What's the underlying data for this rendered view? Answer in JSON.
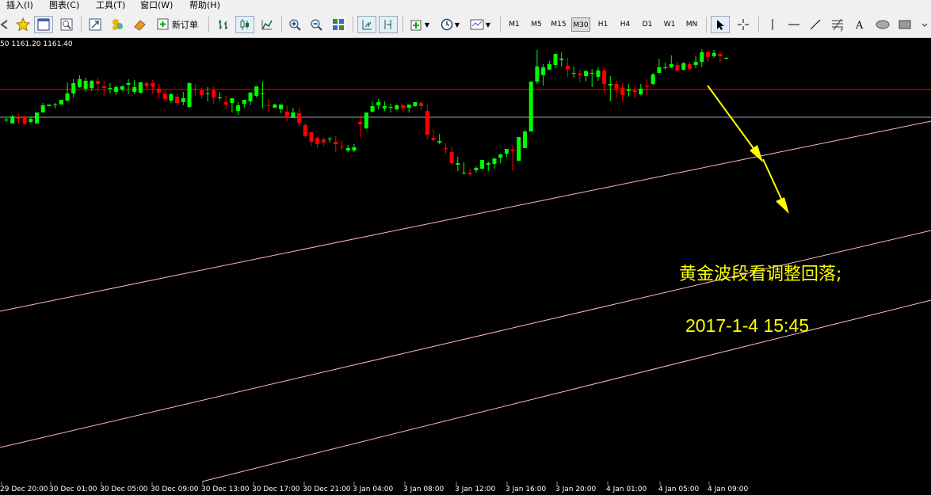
{
  "menu": [
    "插入(I)",
    "图表(C)",
    "工具(T)",
    "窗口(W)",
    "帮助(H)"
  ],
  "toolbar": {
    "new_order_label": "新订单",
    "timeframes": [
      "M1",
      "M5",
      "M15",
      "M30",
      "H1",
      "H4",
      "D1",
      "W1",
      "MN"
    ],
    "selected_timeframe": "M30"
  },
  "chart": {
    "price_info": "50 1161.20 1161.40",
    "annotation_title": "黄金波段看调整回落;",
    "annotation_date": "2017-1-4  15:45",
    "x_labels": [
      "29 Dec 20:00",
      "30 Dec 01:00",
      "30 Dec 05:00",
      "30 Dec 09:00",
      "30 Dec 13:00",
      "30 Dec 17:00",
      "30 Dec 21:00",
      "3 Jan 04:00",
      "3 Jan 08:00",
      "3 Jan 12:00",
      "3 Jan 16:00",
      "3 Jan 20:00",
      "4 Jan 01:00",
      "4 Jan 05:00",
      "4 Jan 09:00"
    ],
    "colors": {
      "bull": "#00ff00",
      "bear": "#ff0000",
      "trend": "#ffb6c1",
      "hline": "#ff0000",
      "price_line": "#9aa6b8",
      "arrow": "#ffff00",
      "text": "#ffff00"
    }
  },
  "chart_data": {
    "type": "candlestick",
    "series": [
      {
        "name": "",
        "values": [
          [
            1216,
            1219,
            1217,
            1214
          ],
          [
            1212,
            1223,
            1221,
            1212
          ],
          [
            1221,
            1224,
            1218,
            1212
          ],
          [
            1219,
            1222,
            1212,
            1210
          ],
          [
            1214,
            1221,
            1218,
            1212
          ],
          [
            1212,
            1226,
            1226,
            1212
          ],
          [
            1226,
            1238,
            1235,
            1232
          ],
          [
            1234,
            1236,
            1236,
            1234
          ],
          [
            1235,
            1238,
            1236,
            1231
          ],
          [
            1236,
            1240,
            1242,
            1247
          ],
          [
            1241,
            1264,
            1250,
            1240
          ],
          [
            1250,
            1268,
            1263,
            1245
          ],
          [
            1258,
            1273,
            1268,
            1257
          ],
          [
            1256,
            1270,
            1266,
            1252
          ],
          [
            1257,
            1267,
            1266,
            1253
          ],
          [
            1266,
            1270,
            1262,
            1252
          ],
          [
            1259,
            1266,
            1257,
            1246
          ],
          [
            1256,
            1263,
            1257,
            1250
          ],
          [
            1252,
            1260,
            1258,
            1248
          ],
          [
            1255,
            1260,
            1259,
            1253
          ],
          [
            1261,
            1268,
            1263,
            1249
          ],
          [
            1252,
            1267,
            1258,
            1249
          ],
          [
            1251,
            1264,
            1264,
            1250
          ],
          [
            1263,
            1266,
            1259,
            1256
          ],
          [
            1263,
            1267,
            1258,
            1249
          ],
          [
            1256,
            1262,
            1251,
            1243
          ],
          [
            1250,
            1254,
            1243,
            1239
          ],
          [
            1241,
            1251,
            1249,
            1238
          ],
          [
            1246,
            1249,
            1238,
            1234
          ],
          [
            1239,
            1252,
            1244,
            1235
          ],
          [
            1233,
            1264,
            1263,
            1232
          ],
          [
            1256,
            1262,
            1255,
            1247
          ],
          [
            1254,
            1257,
            1248,
            1243
          ],
          [
            1249,
            1258,
            1250,
            1240
          ],
          [
            1254,
            1259,
            1245,
            1237
          ],
          [
            1245,
            1252,
            1245,
            1241
          ],
          [
            1239,
            1247,
            1236,
            1230
          ],
          [
            1238,
            1242,
            1244,
            1226
          ],
          [
            1228,
            1239,
            1235,
            1223
          ],
          [
            1237,
            1242,
            1242,
            1232
          ],
          [
            1240,
            1252,
            1251,
            1235
          ],
          [
            1247,
            1258,
            1259,
            1245
          ],
          [
            1250,
            1265,
            1250,
            1231
          ],
          [
            1235,
            1243,
            1234,
            1227
          ],
          [
            1232,
            1237,
            1236,
            1232
          ],
          [
            1230,
            1234,
            1236,
            1225
          ],
          [
            1227,
            1235,
            1219,
            1215
          ],
          [
            1219,
            1232,
            1226,
            1219
          ],
          [
            1225,
            1232,
            1213,
            1208
          ],
          [
            1210,
            1213,
            1196,
            1194
          ],
          [
            1201,
            1202,
            1189,
            1184
          ],
          [
            1194,
            1196,
            1186,
            1181
          ],
          [
            1192,
            1195,
            1188,
            1184
          ],
          [
            1192,
            1195,
            1193,
            1188
          ],
          [
            1189,
            1196,
            1186,
            1176
          ],
          [
            1183,
            1190,
            1182,
            1179
          ],
          [
            1178,
            1185,
            1181,
            1176
          ],
          [
            1178,
            1186,
            1182,
            1176
          ],
          [
            1214,
            1222,
            1211,
            1195
          ],
          [
            1206,
            1220,
            1226,
            1205
          ],
          [
            1227,
            1240,
            1234,
            1226
          ],
          [
            1235,
            1243,
            1239,
            1230
          ],
          [
            1231,
            1240,
            1234,
            1228
          ],
          [
            1232,
            1237,
            1233,
            1226
          ],
          [
            1230,
            1236,
            1235,
            1229
          ],
          [
            1235,
            1237,
            1232,
            1226
          ],
          [
            1232,
            1236,
            1236,
            1226
          ],
          [
            1234,
            1238,
            1239,
            1233
          ],
          [
            1238,
            1241,
            1234,
            1229
          ],
          [
            1228,
            1236,
            1198,
            1192
          ],
          [
            1194,
            1205,
            1191,
            1189
          ],
          [
            1188,
            1199,
            1190,
            1186
          ],
          [
            1181,
            1188,
            1180,
            1174
          ],
          [
            1176,
            1183,
            1162,
            1160
          ],
          [
            1160,
            1170,
            1162,
            1152
          ],
          [
            1150,
            1163,
            1150,
            1148
          ],
          [
            1150,
            1155,
            1148,
            1145
          ],
          [
            1153,
            1158,
            1156,
            1150
          ],
          [
            1155,
            1166,
            1166,
            1155
          ],
          [
            1160,
            1164,
            1162,
            1152
          ],
          [
            1161,
            1166,
            1168,
            1155
          ],
          [
            1169,
            1174,
            1173,
            1162
          ],
          [
            1174,
            1180,
            1180,
            1170
          ],
          [
            1179,
            1185,
            1177,
            1152
          ],
          [
            1165,
            1192,
            1195,
            1165
          ],
          [
            1181,
            1203,
            1202,
            1181
          ],
          [
            1202,
            1248,
            1265,
            1202
          ],
          [
            1265,
            1305,
            1284,
            1262
          ],
          [
            1273,
            1287,
            1283,
            1260
          ],
          [
            1280,
            1291,
            1287,
            1280
          ],
          [
            1286,
            1296,
            1300,
            1282
          ],
          [
            1292,
            1302,
            1294,
            1284
          ],
          [
            1285,
            1295,
            1281,
            1271
          ],
          [
            1275,
            1284,
            1276,
            1270
          ],
          [
            1275,
            1280,
            1273,
            1264
          ],
          [
            1272,
            1280,
            1278,
            1265
          ],
          [
            1275,
            1281,
            1276,
            1258
          ],
          [
            1271,
            1283,
            1279,
            1266
          ],
          [
            1279,
            1282,
            1262,
            1250
          ],
          [
            1260,
            1272,
            1262,
            1240
          ],
          [
            1262,
            1266,
            1256,
            1245
          ],
          [
            1257,
            1263,
            1248,
            1240
          ],
          [
            1253,
            1262,
            1255,
            1246
          ],
          [
            1254,
            1260,
            1252,
            1244
          ],
          [
            1249,
            1262,
            1256,
            1248
          ],
          [
            1259,
            1268,
            1258,
            1248
          ],
          [
            1262,
            1276,
            1274,
            1260
          ],
          [
            1276,
            1294,
            1283,
            1276
          ],
          [
            1282,
            1289,
            1283,
            1280
          ],
          [
            1283,
            1298,
            1287,
            1282
          ],
          [
            1286,
            1290,
            1279,
            1277
          ],
          [
            1280,
            1290,
            1288,
            1279
          ],
          [
            1287,
            1290,
            1281,
            1279
          ],
          [
            1286,
            1297,
            1290,
            1282
          ],
          [
            1290,
            1306,
            1302,
            1283
          ],
          [
            1302,
            1305,
            1296,
            1290
          ],
          [
            1297,
            1305,
            1301,
            1295
          ],
          [
            1300,
            1303,
            1297,
            1289
          ],
          [
            1294,
            1296,
            1295,
            1293
          ]
        ]
      }
    ],
    "value_format": "[open, high, close, low] approximate, arbitrary price units",
    "x_labels": [
      "29 Dec 20:00",
      "30 Dec 01:00",
      "30 Dec 05:00",
      "30 Dec 09:00",
      "30 Dec 13:00",
      "30 Dec 17:00",
      "30 Dec 21:00",
      "3 Jan 04:00",
      "3 Jan 08:00",
      "3 Jan 12:00",
      "3 Jan 16:00",
      "3 Jan 20:00",
      "4 Jan 01:00",
      "4 Jan 05:00",
      "4 Jan 09:00"
    ]
  }
}
